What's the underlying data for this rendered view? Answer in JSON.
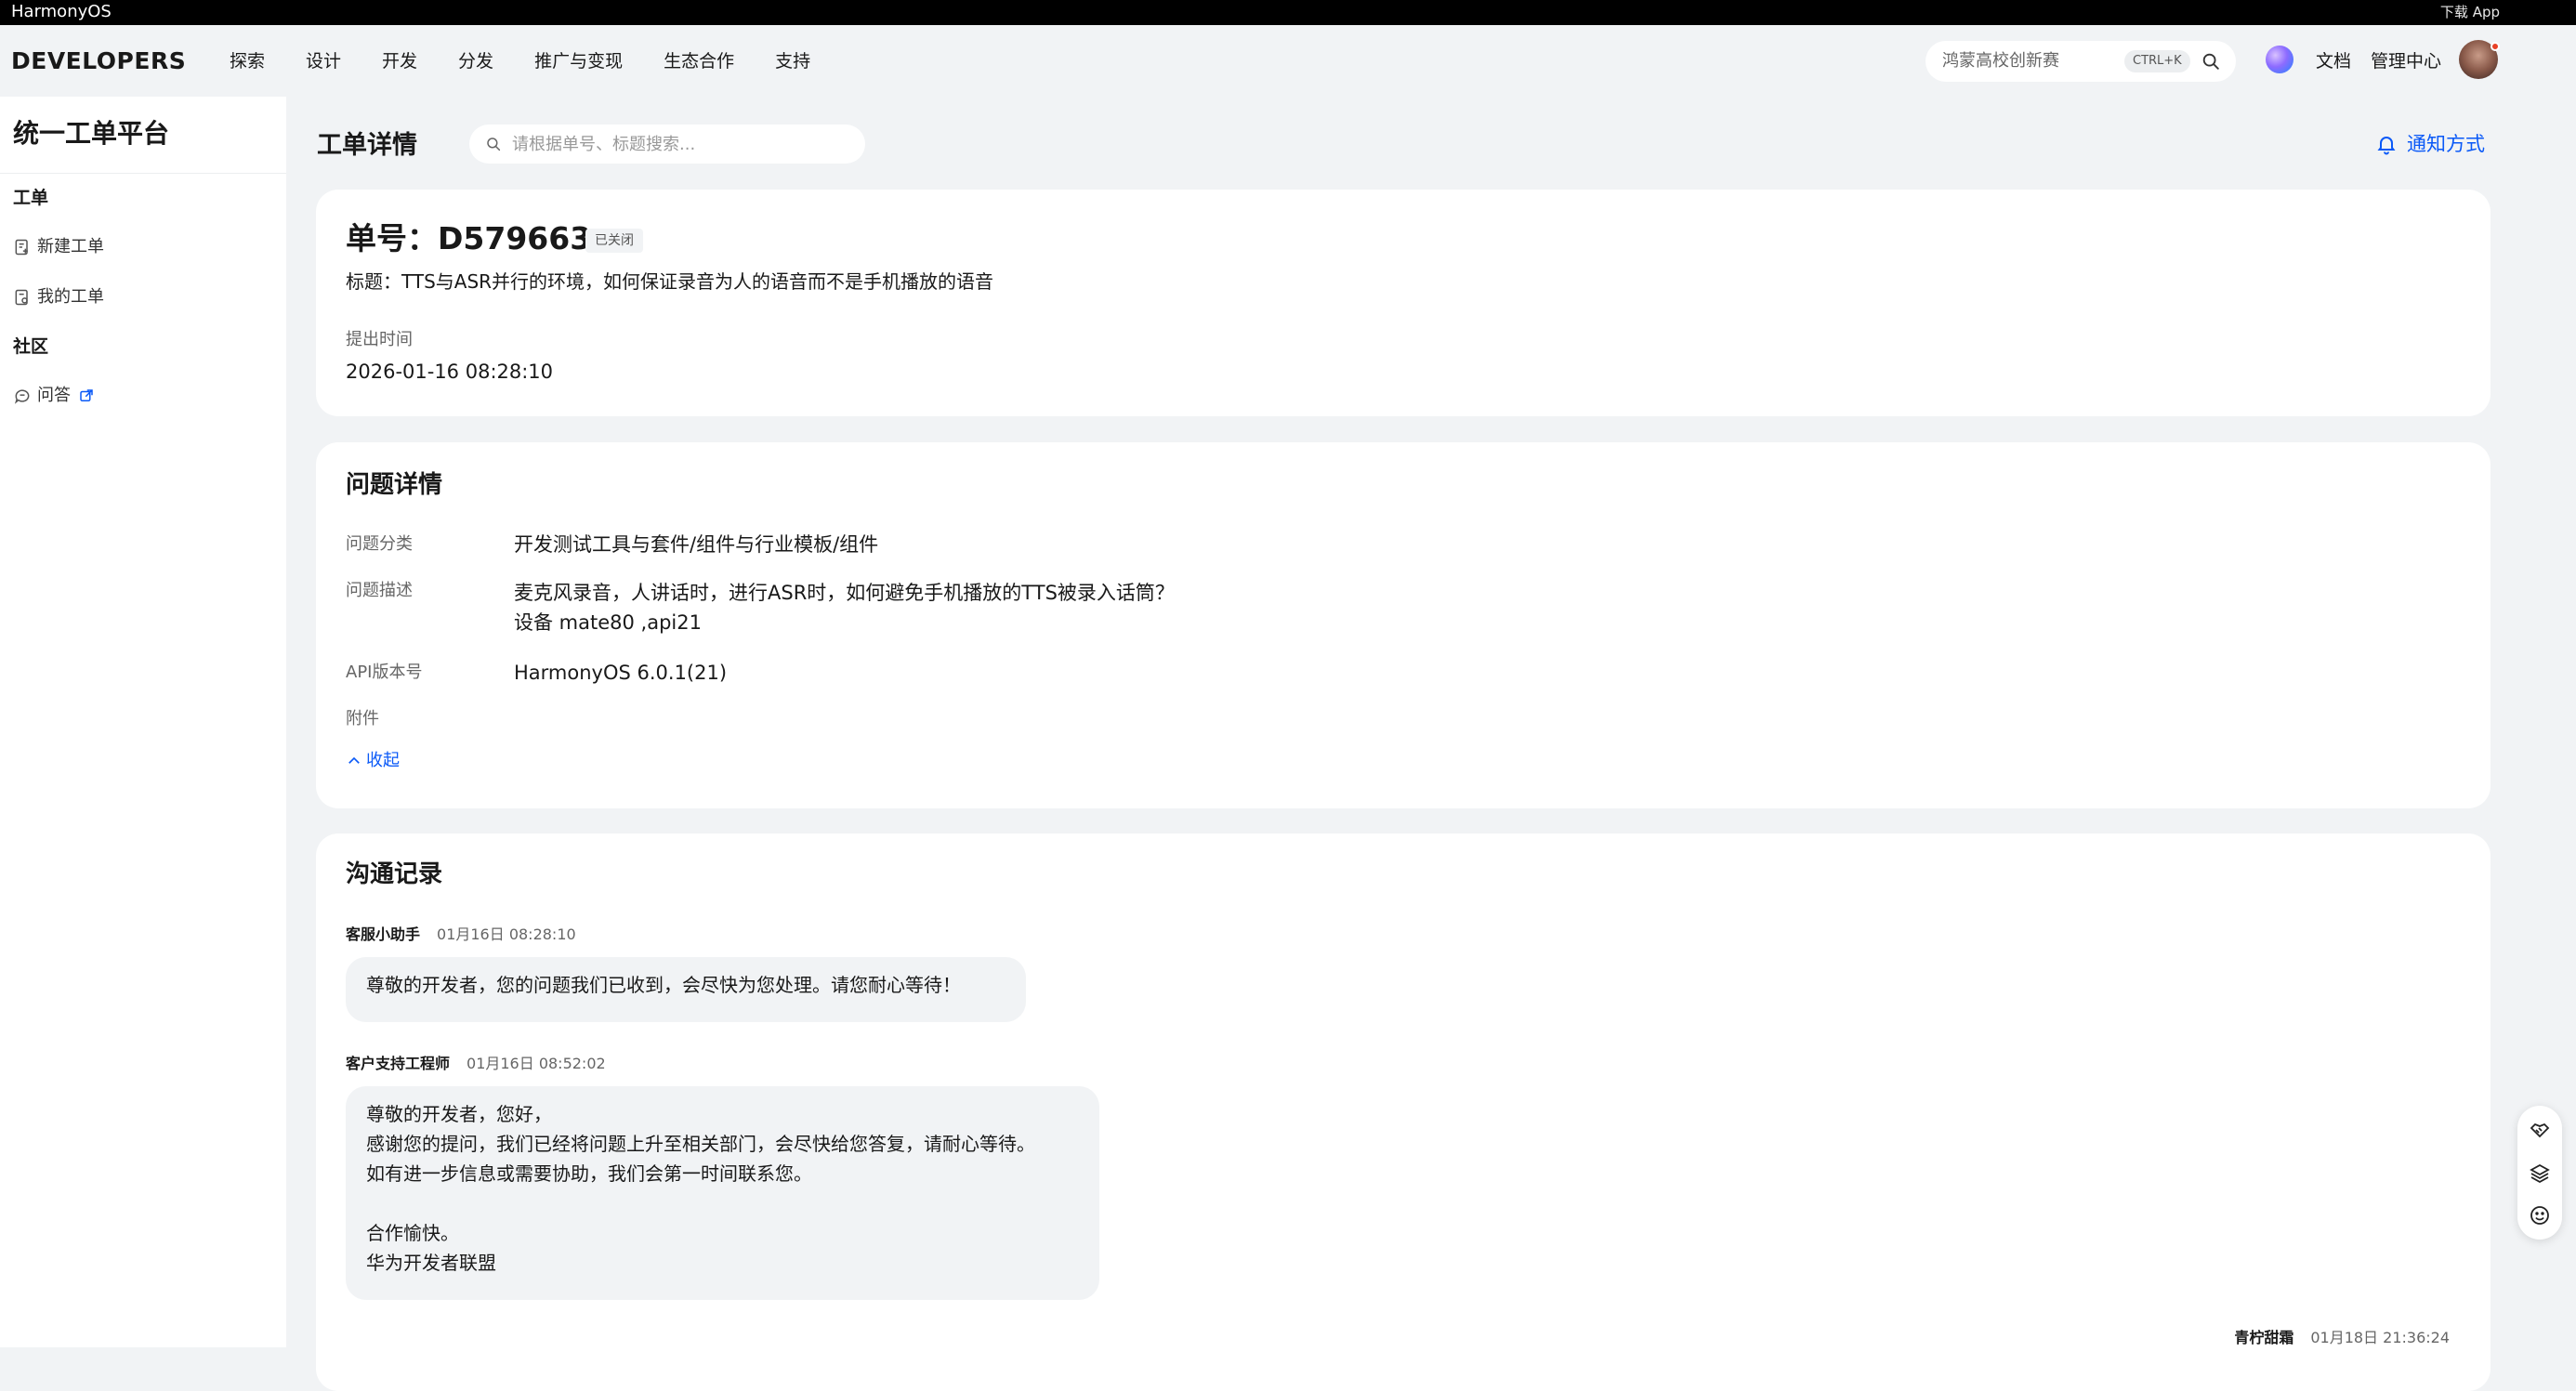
{
  "topbar": {
    "brand": "HarmonyOS",
    "download": "下载 App"
  },
  "header": {
    "logo": "DEVELOPERS",
    "nav": [
      "探索",
      "设计",
      "开发",
      "分发",
      "推广与变现",
      "生态合作",
      "支持"
    ],
    "search_placeholder": "鸿蒙高校创新赛",
    "search_shortcut": "CTRL+K",
    "docs": "文档",
    "admin": "管理中心"
  },
  "sidebar": {
    "title": "统一工单平台",
    "section_ticket": "工单",
    "new_ticket": "新建工单",
    "my_ticket": "我的工单",
    "section_community": "社区",
    "qa": "问答"
  },
  "main": {
    "title": "工单详情",
    "search_placeholder": "请根据单号、标题搜索...",
    "notify": "通知方式"
  },
  "ticket": {
    "number": "单号：D579663",
    "status": "已关闭",
    "title": "标题：TTS与ASR并行的环境，如何保证录音为人的语音而不是手机播放的语音",
    "submit_label": "提出时间",
    "submit_time": "2026-01-16 08:28:10"
  },
  "detail": {
    "heading": "问题详情",
    "category_label": "问题分类",
    "category": "开发测试工具与套件/组件与行业模板/组件",
    "desc_label": "问题描述",
    "desc_line1": "麦克风录音，人讲话时，进行ASR时，如何避免手机播放的TTS被录入话筒？",
    "desc_line2": "设备 mate80 ,api21",
    "api_label": "API版本号",
    "api": "HarmonyOS 6.0.1(21)",
    "attach_label": "附件",
    "collapse": "收起"
  },
  "comm": {
    "heading": "沟通记录",
    "msg1_sender": "客服小助手",
    "msg1_time": "01月16日 08:28:10",
    "msg1_text": "尊敬的开发者，您的问题我们已收到，会尽快为您处理。请您耐心等待！",
    "msg2_sender": "客户支持工程师",
    "msg2_time": "01月16日 08:52:02",
    "msg2_l1": "尊敬的开发者，您好，",
    "msg2_l2": "感谢您的提问，我们已经将问题上升至相关部门，会尽快给您答复，请耐心等待。",
    "msg2_l3": "如有进一步信息或需要协助，我们会第一时间联系您。",
    "msg2_l4": "合作愉快。",
    "msg2_l5": "华为开发者联盟",
    "msg3_sender": "青柠甜霜",
    "msg3_time": "01月18日 21:36:24"
  },
  "colors": {
    "accent": "#0a59f7",
    "page_bg": "#f1f3f5",
    "bubble_bg": "#f1f3f5"
  },
  "icons": [
    "search-icon",
    "bell-icon",
    "new-ticket-icon",
    "my-ticket-icon",
    "qa-icon",
    "external-link-icon",
    "chevron-up-icon",
    "handshake-icon",
    "layers-icon",
    "smile-icon"
  ]
}
